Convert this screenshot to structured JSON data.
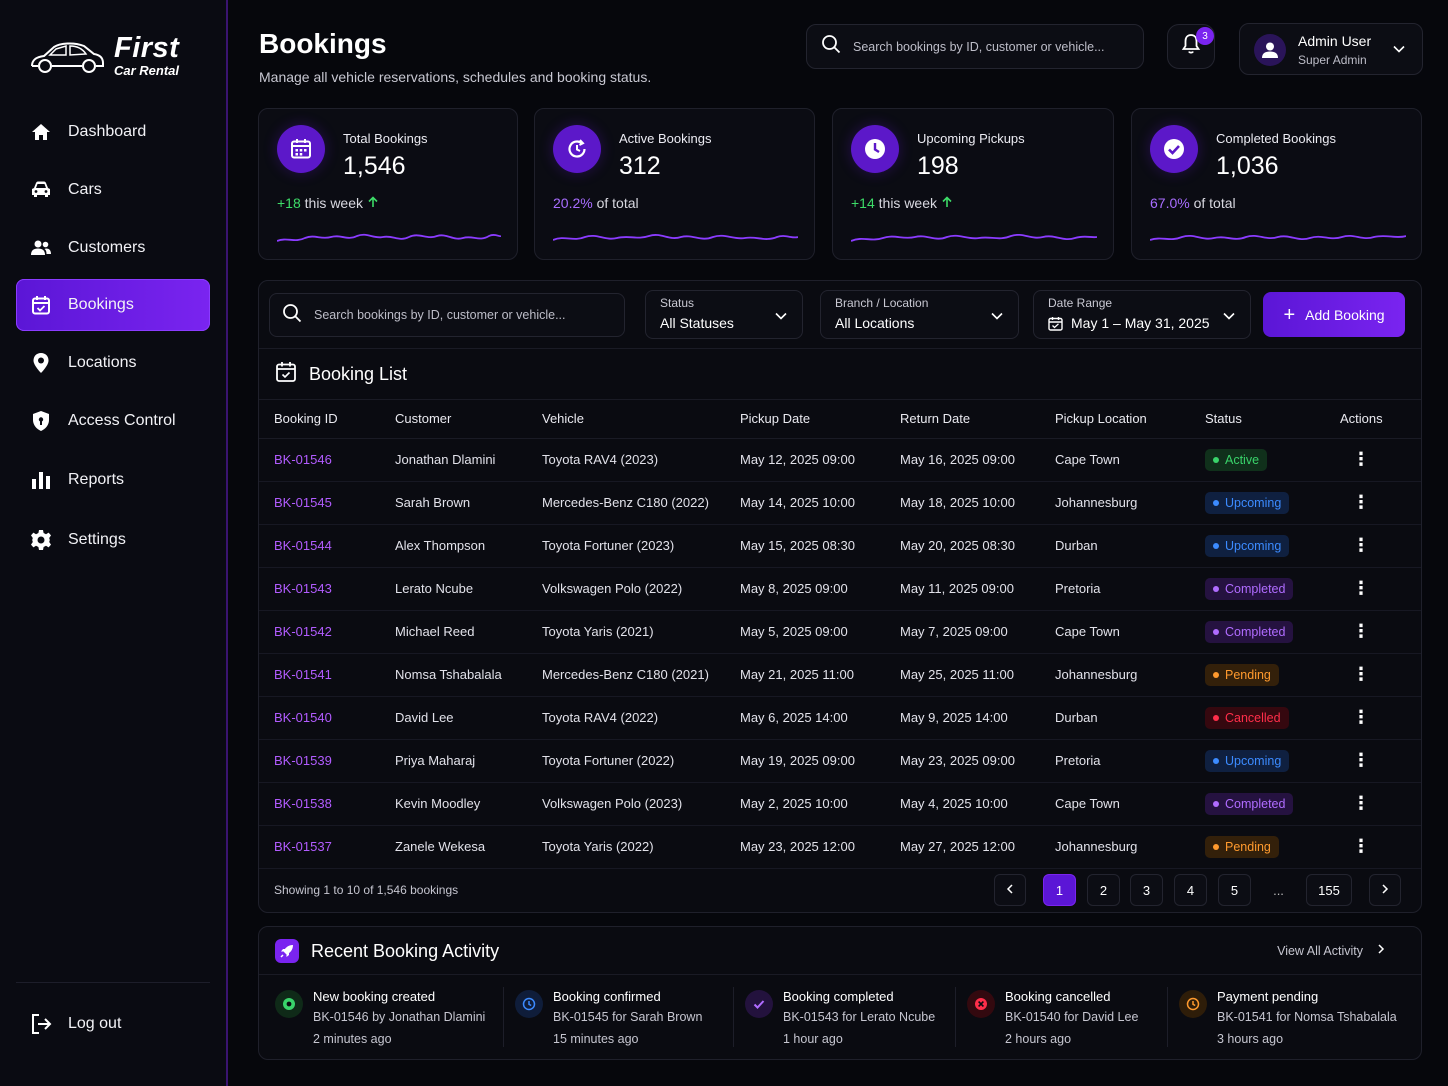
{
  "brand": {
    "name": "First",
    "sub": "Car Rental"
  },
  "sidebar": {
    "items": [
      {
        "label": "Dashboard",
        "icon": "home-icon"
      },
      {
        "label": "Cars",
        "icon": "car-icon"
      },
      {
        "label": "Customers",
        "icon": "users-icon"
      },
      {
        "label": "Bookings",
        "icon": "calendar-icon",
        "active": true
      },
      {
        "label": "Locations",
        "icon": "location-pin-icon"
      },
      {
        "label": "Access Control",
        "icon": "shield-icon"
      },
      {
        "label": "Reports",
        "icon": "bar-chart-icon"
      },
      {
        "label": "Settings",
        "icon": "gear-icon"
      }
    ],
    "logout": "Log out"
  },
  "header": {
    "title": "Bookings",
    "subtitle": "Manage all vehicle reservations, schedules and booking status.",
    "search_placeholder": "Search bookings by ID, customer or vehicle...",
    "notifications": "3",
    "user_name": "Admin User",
    "user_role": "Super Admin"
  },
  "stats": [
    {
      "label": "Total Bookings",
      "value": "1,546",
      "highlight": "+18",
      "rest": "this week",
      "trend": "up"
    },
    {
      "label": "Active Bookings",
      "value": "312",
      "highlight": "20.2%",
      "rest": "of total"
    },
    {
      "label": "Upcoming Pickups",
      "value": "198",
      "highlight": "+14",
      "rest": "this week",
      "trend": "up"
    },
    {
      "label": "Completed Bookings",
      "value": "1,036",
      "highlight": "67.0%",
      "rest": "of total"
    }
  ],
  "filters": {
    "search_placeholder": "Search bookings by ID, customer or vehicle...",
    "status_label": "Status",
    "status_value": "All Statuses",
    "branch_label": "Branch / Location",
    "branch_value": "All Locations",
    "date_label": "Date Range",
    "date_value": "May 1 – May 31, 2025",
    "add_button": "Add Booking"
  },
  "list": {
    "title": "Booking List",
    "columns": [
      "Booking ID",
      "Customer",
      "Vehicle",
      "Pickup Date",
      "Return Date",
      "Pickup Location",
      "Status",
      "Actions"
    ],
    "rows": [
      {
        "id": "BK-01546",
        "customer": "Jonathan Dlamini",
        "vehicle": "Toyota RAV4 (2023)",
        "pickup": "May 12, 2025 09:00",
        "return": "May 16, 2025 09:00",
        "location": "Cape Town",
        "status": "Active",
        "kind": "active"
      },
      {
        "id": "BK-01545",
        "customer": "Sarah Brown",
        "vehicle": "Mercedes-Benz C180 (2022)",
        "pickup": "May 14, 2025 10:00",
        "return": "May 18, 2025 10:00",
        "location": "Johannesburg",
        "status": "Upcoming",
        "kind": "upcoming"
      },
      {
        "id": "BK-01544",
        "customer": "Alex Thompson",
        "vehicle": "Toyota Fortuner (2023)",
        "pickup": "May 15, 2025 08:30",
        "return": "May 20, 2025 08:30",
        "location": "Durban",
        "status": "Upcoming",
        "kind": "upcoming"
      },
      {
        "id": "BK-01543",
        "customer": "Lerato Ncube",
        "vehicle": "Volkswagen Polo (2022)",
        "pickup": "May 8, 2025 09:00",
        "return": "May 11, 2025 09:00",
        "location": "Pretoria",
        "status": "Completed",
        "kind": "completed"
      },
      {
        "id": "BK-01542",
        "customer": "Michael Reed",
        "vehicle": "Toyota Yaris (2021)",
        "pickup": "May 5, 2025 09:00",
        "return": "May 7, 2025 09:00",
        "location": "Cape Town",
        "status": "Completed",
        "kind": "completed"
      },
      {
        "id": "BK-01541",
        "customer": "Nomsa Tshabalala",
        "vehicle": "Mercedes-Benz C180 (2021)",
        "pickup": "May 21, 2025 11:00",
        "return": "May 25, 2025 11:00",
        "location": "Johannesburg",
        "status": "Pending",
        "kind": "pending"
      },
      {
        "id": "BK-01540",
        "customer": "David Lee",
        "vehicle": "Toyota RAV4 (2022)",
        "pickup": "May 6, 2025 14:00",
        "return": "May 9, 2025 14:00",
        "location": "Durban",
        "status": "Cancelled",
        "kind": "cancelled"
      },
      {
        "id": "BK-01539",
        "customer": "Priya Maharaj",
        "vehicle": "Toyota Fortuner (2022)",
        "pickup": "May 19, 2025 09:00",
        "return": "May 23, 2025 09:00",
        "location": "Pretoria",
        "status": "Upcoming",
        "kind": "upcoming"
      },
      {
        "id": "BK-01538",
        "customer": "Kevin Moodley",
        "vehicle": "Volkswagen Polo (2023)",
        "pickup": "May 2, 2025 10:00",
        "return": "May 4, 2025 10:00",
        "location": "Cape Town",
        "status": "Completed",
        "kind": "completed"
      },
      {
        "id": "BK-01537",
        "customer": "Zanele Wekesa",
        "vehicle": "Toyota Yaris (2022)",
        "pickup": "May 23, 2025 12:00",
        "return": "May 27, 2025 12:00",
        "location": "Johannesburg",
        "status": "Pending",
        "kind": "pending"
      }
    ],
    "showing": "Showing 1 to 10 of 1,546 bookings",
    "pages": [
      "1",
      "2",
      "3",
      "4",
      "5",
      "...",
      "155"
    ],
    "current_page": "1"
  },
  "activity": {
    "title": "Recent Booking Activity",
    "view_all": "View All Activity",
    "items": [
      {
        "title": "New booking created",
        "detail": "BK-01546 by Jonathan Dlamini",
        "time": "2 minutes ago",
        "icon": "plus-circle-icon",
        "color": "#39d36a"
      },
      {
        "title": "Booking confirmed",
        "detail": "BK-01545 for Sarah Brown",
        "time": "15 minutes ago",
        "icon": "clock-icon",
        "color": "#3c8bff"
      },
      {
        "title": "Booking completed",
        "detail": "BK-01543 for Lerato Ncube",
        "time": "1 hour ago",
        "icon": "check-icon",
        "color": "#b06cff"
      },
      {
        "title": "Booking cancelled",
        "detail": "BK-01540 for David Lee",
        "time": "2 hours ago",
        "icon": "x-circle-icon",
        "color": "#ff2e4a"
      },
      {
        "title": "Payment pending",
        "detail": "BK-01541 for Nomsa Tshabalala",
        "time": "3 hours ago",
        "icon": "clock-icon",
        "color": "#ff9a2e"
      }
    ]
  }
}
